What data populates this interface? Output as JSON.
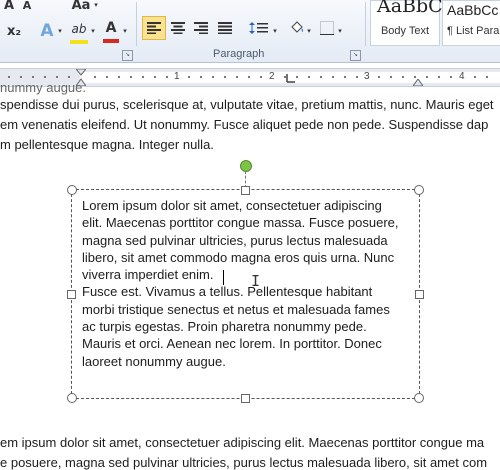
{
  "ribbon": {
    "font_buttons": {
      "grow_label": "A",
      "case_label": "Aa",
      "subscript_label": "x₂",
      "text_effects_label": "A",
      "highlight_label": "ab",
      "font_color_label": "A"
    },
    "paragraph_group_label": "Paragraph",
    "styles": [
      {
        "sample": "AaBbCc",
        "name": "Body Text"
      },
      {
        "sample": "AaBbCc",
        "name": "¶ List Para..."
      }
    ],
    "colors": {
      "highlight": "#f2e21a",
      "font_color": "#d42a20",
      "accent": "#f5c74a"
    }
  },
  "ruler": {
    "numbers": [
      "1",
      "2",
      "3",
      "4"
    ]
  },
  "document": {
    "lines_top": [
      "nummy augue.",
      "spendisse dui purus, scelerisque at, vulputate vitae, pretium mattis, nunc. Mauris eget",
      "em venenatis eleifend. Ut nonummy. Fusce aliquet pede non pede. Suspendisse dap",
      "m pellentesque magna. Integer nulla."
    ],
    "textbox_lines": [
      "Lorem ipsum dolor sit amet, consectetuer adipiscing",
      "elit. Maecenas porttitor congue massa. Fusce posuere,",
      "magna sed pulvinar ultricies, purus lectus malesuada",
      "libero, sit amet commodo magna eros quis urna. Nunc",
      "viverra imperdiet enim.",
      "Fusce est. Vivamus a tellus. Pellentesque habitant",
      "morbi tristique senectus et netus et malesuada fames",
      "ac turpis egestas. Proin pharetra nonummy pede.",
      "Mauris et orci.  Aenean nec lorem. In porttitor. Donec",
      "laoreet nonummy augue."
    ],
    "lines_bottom": [
      "em ipsum dolor sit amet, consectetuer adipiscing elit. Maecenas porttitor congue ma",
      "e posuere, magna sed pulvinar ultricies, purus lectus malesuada libero, sit amet com"
    ]
  }
}
